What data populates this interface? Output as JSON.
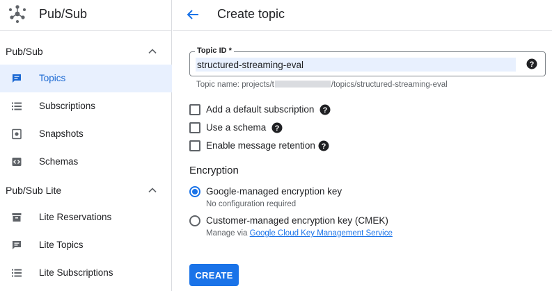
{
  "app": {
    "title": "Pub/Sub"
  },
  "sidebar": {
    "sections": [
      {
        "label": "Pub/Sub",
        "items": [
          {
            "label": "Topics",
            "icon": "topics-icon",
            "active": true
          },
          {
            "label": "Subscriptions",
            "icon": "list-icon"
          },
          {
            "label": "Snapshots",
            "icon": "snapshot-icon"
          },
          {
            "label": "Schemas",
            "icon": "code-icon"
          }
        ]
      },
      {
        "label": "Pub/Sub Lite",
        "items": [
          {
            "label": "Lite Reservations",
            "icon": "reservations-icon"
          },
          {
            "label": "Lite Topics",
            "icon": "topics-icon"
          },
          {
            "label": "Lite Subscriptions",
            "icon": "list-icon"
          }
        ]
      }
    ]
  },
  "header": {
    "title": "Create topic"
  },
  "form": {
    "topic_id_label": "Topic ID *",
    "topic_id_value": "structured-streaming-eval",
    "topic_name_prefix": "Topic name: projects/t",
    "topic_name_suffix": "/topics/structured-streaming-eval",
    "options": [
      {
        "label": "Add a default subscription",
        "checked": false
      },
      {
        "label": "Use a schema",
        "checked": false
      },
      {
        "label": "Enable message retention",
        "checked": false
      }
    ],
    "encryption": {
      "heading": "Encryption",
      "google_label": "Google-managed encryption key",
      "google_sub": "No configuration required",
      "cmek_label": "Customer-managed encryption key (CMEK)",
      "cmek_sub_prefix": "Manage via ",
      "cmek_link": "Google Cloud Key Management Service",
      "selected": "google"
    },
    "create_label": "CREATE"
  },
  "colors": {
    "accent": "#1a73e8",
    "active_bg": "#e8f0fe",
    "border": "#dadce0"
  }
}
